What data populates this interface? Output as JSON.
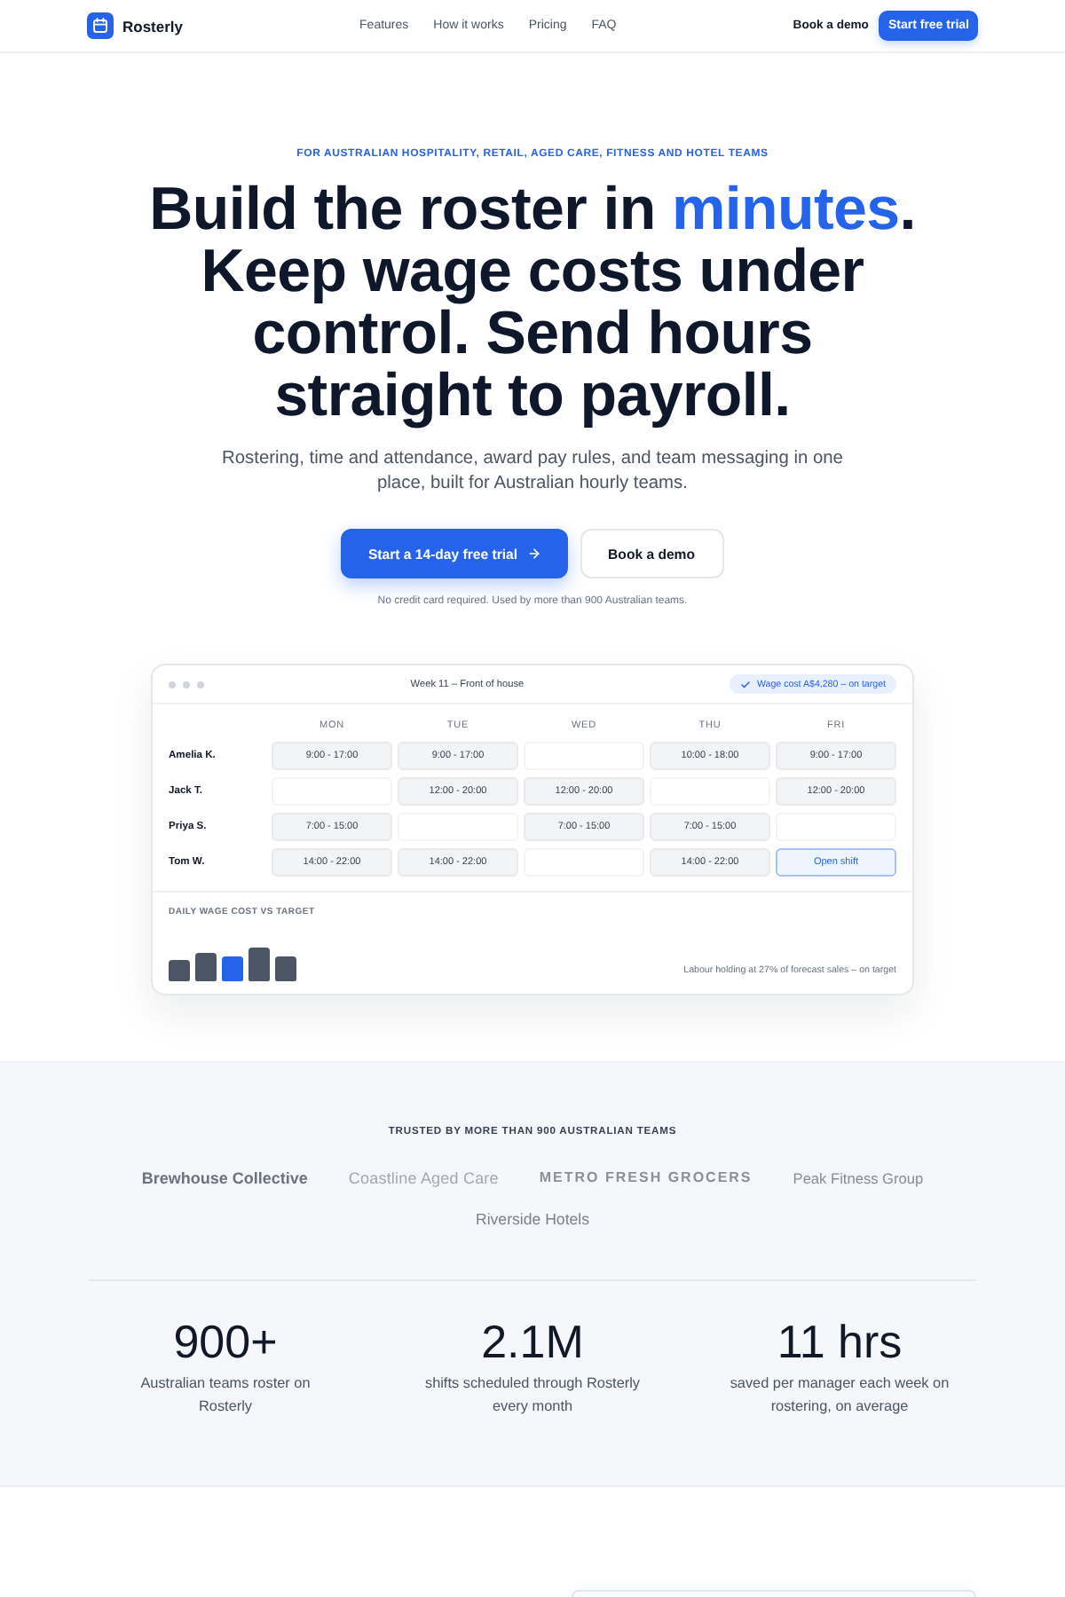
{
  "header": {
    "brand": "Rosterly",
    "nav": [
      {
        "label": "Features"
      },
      {
        "label": "How it works"
      },
      {
        "label": "Pricing"
      },
      {
        "label": "FAQ"
      }
    ],
    "demo_link": "Book a demo",
    "cta_button": "Start free trial"
  },
  "hero": {
    "eyebrow": "FOR AUSTRALIAN HOSPITALITY, RETAIL, AGED CARE, FITNESS AND HOTEL TEAMS",
    "headline": [
      {
        "text": "Build the roster in ",
        "accent": false
      },
      {
        "text": "minutes",
        "accent": true
      },
      {
        "text": ". Keep wage costs under control. Send hours straight to payroll.",
        "accent": false
      }
    ],
    "subtitle": "Rostering, time and attendance, award pay rules, and team messaging in one place, built for Australian hourly teams.",
    "primary_button": "Start a 14-day free trial",
    "secondary_button": "Book a demo",
    "note": "No credit card required. Used by more than 900 Australian teams."
  },
  "roster_preview": {
    "title": "Week 11 – Front of house",
    "badge": "Wage cost A$4,280 – on target",
    "days": [
      "MON",
      "TUE",
      "WED",
      "THU",
      "FRI"
    ],
    "rows": [
      {
        "name": "Amelia K.",
        "shifts": [
          {
            "kind": "shift",
            "time": "9:00 - 17:00"
          },
          {
            "kind": "shift",
            "time": "9:00 - 17:00"
          },
          {
            "kind": "empty"
          },
          {
            "kind": "shift",
            "time": "10:00 - 18:00"
          },
          {
            "kind": "shift",
            "time": "9:00 - 17:00"
          }
        ]
      },
      {
        "name": "Jack T.",
        "shifts": [
          {
            "kind": "empty"
          },
          {
            "kind": "shift",
            "time": "12:00 - 20:00"
          },
          {
            "kind": "shift",
            "time": "12:00 - 20:00"
          },
          {
            "kind": "empty"
          },
          {
            "kind": "shift",
            "time": "12:00 - 20:00"
          }
        ]
      },
      {
        "name": "Priya S.",
        "shifts": [
          {
            "kind": "shift",
            "time": "7:00 - 15:00"
          },
          {
            "kind": "empty"
          },
          {
            "kind": "shift",
            "time": "7:00 - 15:00"
          },
          {
            "kind": "shift",
            "time": "7:00 - 15:00"
          },
          {
            "kind": "empty"
          }
        ]
      },
      {
        "name": "Tom W.",
        "shifts": [
          {
            "kind": "shift",
            "time": "14:00 - 22:00"
          },
          {
            "kind": "shift",
            "time": "14:00 - 22:00"
          },
          {
            "kind": "empty"
          },
          {
            "kind": "shift",
            "time": "14:00 - 22:00"
          },
          {
            "kind": "open",
            "time": "Open shift"
          }
        ]
      }
    ],
    "wage_chart": {
      "title": "DAILY WAGE COST VS TARGET",
      "bars": [
        {
          "highlighted": false
        },
        {
          "highlighted": false
        },
        {
          "highlighted": true
        },
        {
          "highlighted": false
        },
        {
          "highlighted": false
        }
      ],
      "caption": "Labour holding at 27% of forecast sales – on target"
    }
  },
  "trusted": {
    "title": "TRUSTED BY MORE THAN 900 AUSTRALIAN TEAMS",
    "logos": [
      {
        "name": "Brewhouse Collective",
        "kind": "bold"
      },
      {
        "name": "Coastline Aged Care",
        "kind": "light"
      },
      {
        "name": "METRO FRESH GROCERS",
        "kind": "spaced"
      },
      {
        "name": "Peak Fitness Group",
        "kind": "regular"
      },
      {
        "name": "Riverside Hotels",
        "kind": "medium"
      }
    ]
  },
  "stats": [
    {
      "value": "900+",
      "label": "Australian teams roster on Rosterly"
    },
    {
      "value": "2.1M",
      "label": "shifts scheduled through Rosterly every month"
    },
    {
      "value": "11 hrs",
      "label": "saved per manager each week on rostering, on average"
    }
  ]
}
